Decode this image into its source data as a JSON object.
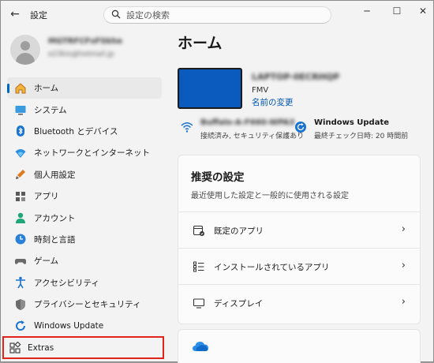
{
  "window": {
    "title": "設定",
    "back_glyph": "←",
    "minimize_glyph": "─",
    "maximize_glyph": "☐",
    "close_glyph": "✕"
  },
  "search": {
    "placeholder": "設定の検索",
    "value": ""
  },
  "profile": {
    "name": "MGTRFCFsFSkhe",
    "email": "e23kis@hotmail.jp"
  },
  "sidebar": {
    "items": [
      {
        "label": "ホーム",
        "icon": "home-icon",
        "selected": true
      },
      {
        "label": "システム",
        "icon": "system-icon"
      },
      {
        "label": "Bluetooth とデバイス",
        "icon": "bluetooth-icon"
      },
      {
        "label": "ネットワークとインターネット",
        "icon": "network-icon"
      },
      {
        "label": "個人用設定",
        "icon": "personalization-icon"
      },
      {
        "label": "アプリ",
        "icon": "apps-icon"
      },
      {
        "label": "アカウント",
        "icon": "account-icon"
      },
      {
        "label": "時刻と言語",
        "icon": "time-language-icon"
      },
      {
        "label": "ゲーム",
        "icon": "gaming-icon"
      },
      {
        "label": "アクセシビリティ",
        "icon": "accessibility-icon"
      },
      {
        "label": "プライバシーとセキュリティ",
        "icon": "privacy-icon"
      },
      {
        "label": "Windows Update",
        "icon": "windows-update-icon"
      }
    ],
    "extras": {
      "label": "Extras",
      "icon": "extras-icon",
      "highlight_color": "#e2231a"
    }
  },
  "main": {
    "title": "ホーム",
    "device": {
      "name": "LAPTOP-0ECRHQP",
      "model": "FMV",
      "rename_link": "名前の変更"
    },
    "status": [
      {
        "title": "Buffalo-A-F660-WPA3",
        "subtitle": "接続済み, セキュリティ保護あり",
        "icon": "wifi-icon"
      },
      {
        "title": "Windows Update",
        "subtitle": "最終チェック日時: 20 時間前",
        "icon": "update-icon"
      }
    ],
    "recommended": {
      "title": "推奨の設定",
      "subtitle": "最近使用した設定と一般的に使用される設定",
      "rows": [
        {
          "label": "既定のアプリ",
          "icon": "default-apps-icon"
        },
        {
          "label": "インストールされているアプリ",
          "icon": "installed-apps-icon"
        },
        {
          "label": "ディスプレイ",
          "icon": "display-icon"
        }
      ]
    },
    "next_card": {
      "icon": "onedrive-icon"
    }
  },
  "colors": {
    "accent": "#0067c0",
    "link": "#0054b0",
    "device_screen": "#0a5bbd",
    "highlight_box": "#e2231a"
  }
}
